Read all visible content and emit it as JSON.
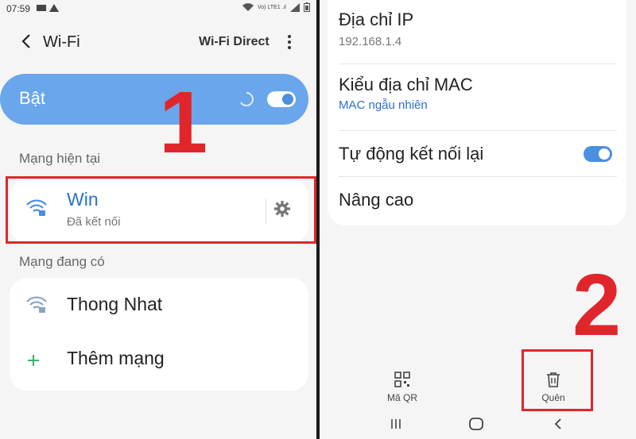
{
  "left": {
    "status": {
      "time": "07:59",
      "signal_text": "Vo) LTE1 .ıl"
    },
    "appbar": {
      "title": "Wi-Fi",
      "action": "Wi-Fi Direct"
    },
    "master_toggle": {
      "label": "Bật",
      "on": true
    },
    "current_section": "Mạng hiện tại",
    "current_network": {
      "name": "Win",
      "status": "Đã kết nối"
    },
    "available_section": "Mạng đang có",
    "available": [
      {
        "name": "Thong Nhat"
      }
    ],
    "add_network": "Thêm mạng",
    "annotation": "1"
  },
  "right": {
    "ip": {
      "label": "Địa chỉ IP",
      "value": "192.168.1.4"
    },
    "mac": {
      "label": "Kiểu địa chỉ MAC",
      "value": "MAC ngẫu nhiên"
    },
    "auto_reconnect": {
      "label": "Tự động kết nối lại",
      "on": true
    },
    "advanced": "Nâng cao",
    "bottom": {
      "qr": "Mã QR",
      "forget": "Quên"
    },
    "annotation": "2"
  },
  "colors": {
    "accent": "#4a8fe0",
    "toggle_card": "#6aa6ec",
    "annotation_red": "#e0262b",
    "link_blue": "#2b6fd1"
  }
}
